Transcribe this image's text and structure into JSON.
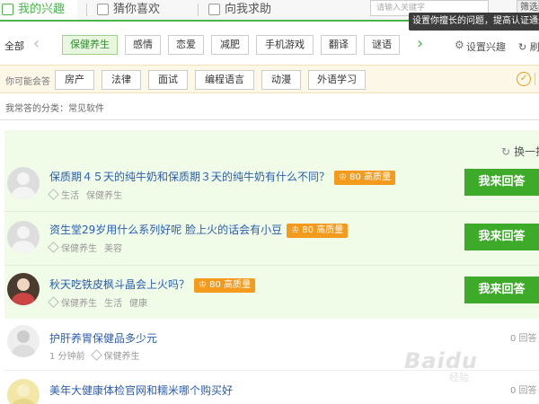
{
  "tabs": [
    {
      "label": "我的兴趣"
    },
    {
      "label": "猜你喜欢"
    },
    {
      "label": "向我求助"
    }
  ],
  "search": {
    "placeholder": "请输入关键字",
    "button": "筛选"
  },
  "tooltip": "设置你擅长的问题，提高认证通过",
  "categories": {
    "all_label": "全部",
    "items": [
      "保健养生",
      "感情",
      "恋爱",
      "减肥",
      "手机游戏",
      "翻译",
      "谜语"
    ],
    "active": "保健养生",
    "settings_label": "设置兴趣",
    "refresh_label": "刷"
  },
  "maybe": {
    "label": "你可能会答",
    "items": [
      "房产",
      "法律",
      "面试",
      "编程语言",
      "动漫",
      "外语学习"
    ]
  },
  "common_line": "我常答的分类：常见软件",
  "swap_label": "换一批",
  "recommended": [
    {
      "title": "保质期４５天的纯牛奶和保质期３天的纯牛奶有什么不同？",
      "badge": "80 高质量",
      "tags": [
        "生活",
        "保健养生"
      ],
      "button": "我来回答"
    },
    {
      "title": "资生堂29岁用什么系列好呢 脸上火的话会有小豆",
      "badge": "80 高质量",
      "tags": [
        "保健养生",
        "美容"
      ],
      "button": "我来回答"
    },
    {
      "title": "秋天吃铁皮枫斗晶会上火吗？",
      "badge": "80 高质量",
      "tags": [
        "保健养生",
        "生活",
        "健康"
      ],
      "button": "我来回答"
    }
  ],
  "others": [
    {
      "title": "护肝养胃保健品多少元",
      "time": "1 分钟前",
      "tags": [
        "保健养生"
      ],
      "count": "0 回答"
    },
    {
      "title": "美年大健康体检官网和糯米哪个购买好",
      "time": "",
      "tags": [],
      "count": "0 回答"
    }
  ],
  "watermark": {
    "brand": "Baidu",
    "sub": "经验"
  }
}
